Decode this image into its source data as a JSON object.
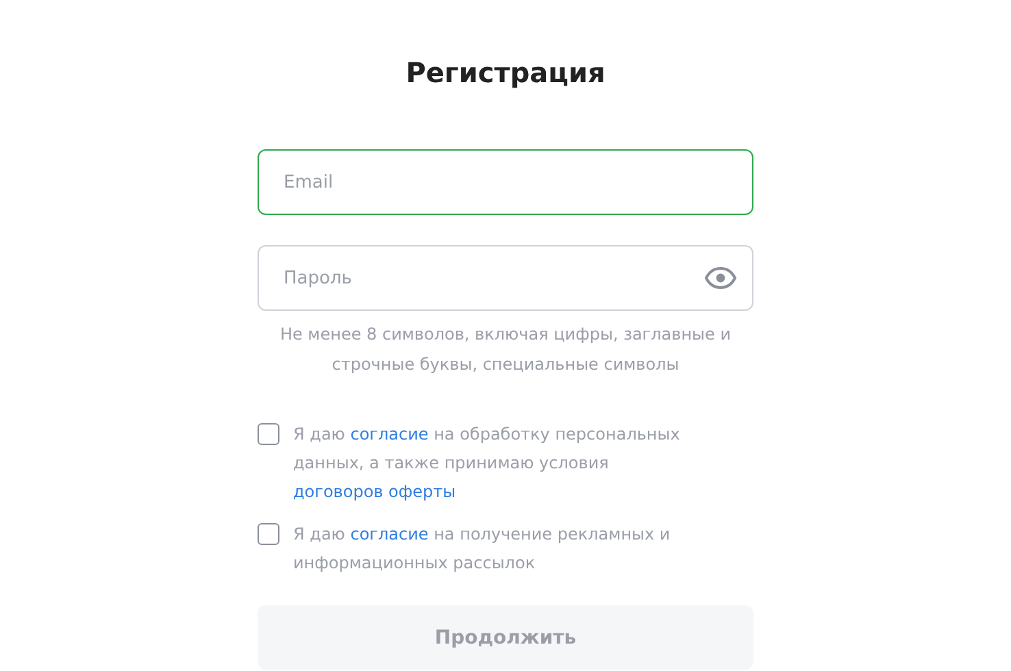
{
  "title": "Регистрация",
  "fields": [
    {
      "placeholder": "Email",
      "focused": true,
      "kind": "text"
    },
    {
      "placeholder": "Пароль",
      "focused": false,
      "kind": "password"
    }
  ],
  "password_hint": "Не менее 8 символов, включая цифры, заглавные и строчные буквы, специальные символы",
  "consents": [
    {
      "checked": false,
      "parts": [
        {
          "kind": "text",
          "text": "Я даю "
        },
        {
          "kind": "link",
          "text": "согласие"
        },
        {
          "kind": "text",
          "text": " на обработку персональных данных, а также принимаю условия "
        },
        {
          "kind": "link",
          "text": "договоров оферты"
        }
      ]
    },
    {
      "checked": false,
      "parts": [
        {
          "kind": "text",
          "text": "Я даю "
        },
        {
          "kind": "link",
          "text": "согласие"
        },
        {
          "kind": "text",
          "text": " на получение рекламных и информационных рассылок"
        }
      ]
    }
  ],
  "submit": {
    "label": "Продолжить",
    "disabled": true
  }
}
